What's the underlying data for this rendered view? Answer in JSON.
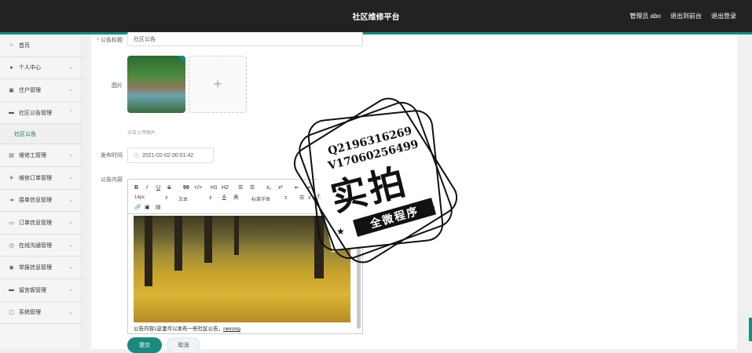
{
  "header": {
    "title": "社区维修平台",
    "user": "管理员 abo",
    "back_link": "退出到前台",
    "logout": "退出登录"
  },
  "sidebar": {
    "items": [
      {
        "label": "首页",
        "icon": "home-icon"
      },
      {
        "label": "个人中心",
        "icon": "user-icon"
      },
      {
        "label": "住户管理",
        "icon": "residents-icon"
      },
      {
        "label": "社区公告管理",
        "icon": "notice-icon",
        "expanded": true
      },
      {
        "label": "维修工管理",
        "icon": "worker-icon"
      },
      {
        "label": "维修订单管理",
        "icon": "order-icon"
      },
      {
        "label": "接单信息管理",
        "icon": "accept-icon"
      },
      {
        "label": "订单信息管理",
        "icon": "info-icon"
      },
      {
        "label": "在线沟通管理",
        "icon": "chat-icon"
      },
      {
        "label": "举报信息管理",
        "icon": "report-icon"
      },
      {
        "label": "留言板管理",
        "icon": "message-icon"
      },
      {
        "label": "系统管理",
        "icon": "system-icon"
      }
    ],
    "subitem": "社区公告"
  },
  "form": {
    "title_label": "公告标题",
    "title_value": "社区公告",
    "image_label": "图片",
    "upload_hint": "点击上传图片",
    "publish_time_label": "发布时间",
    "publish_time_value": "2021-02-02 00:01:42",
    "content_label": "公告内容",
    "content_text": "公告内容1这里可以发布一些社区公告，",
    "content_underlined": "neirong",
    "submit": "提交",
    "cancel": "取消"
  },
  "editor_toolbar": {
    "bold": "B",
    "italic": "I",
    "underline": "U",
    "strike": "S",
    "quote": "99",
    "code": "</>",
    "h1": "H1",
    "h2": "H2",
    "sub": "x₂",
    "sup": "x²",
    "size": "14px",
    "text": "文本",
    "font": "标准字体",
    "color_a": "A",
    "bg_a": "A",
    "clear": "Tx"
  },
  "watermark": {
    "line1": "Q2196316269",
    "line2": "V17060256499",
    "big": "实拍",
    "ribbon": "全微程序"
  }
}
